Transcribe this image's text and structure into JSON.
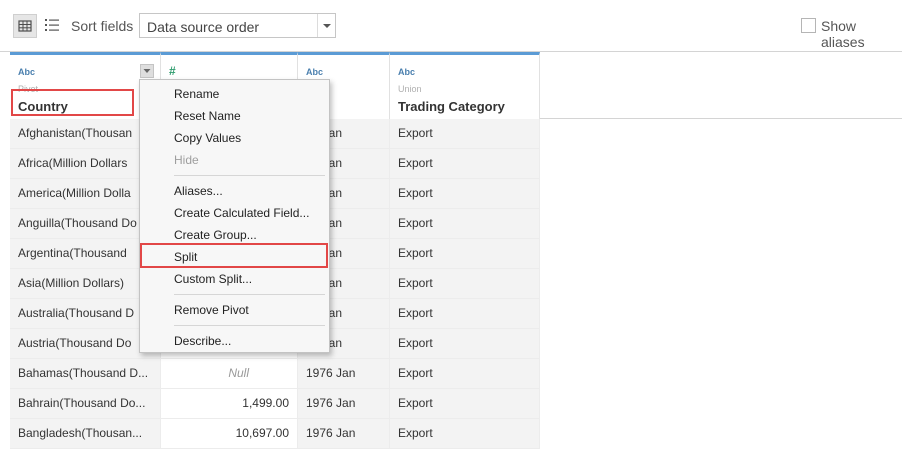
{
  "toolbar": {
    "grid_view_icon": "grid-icon",
    "list_view_icon": "list-icon",
    "sort_label": "Sort fields",
    "sort_value": "Data source order",
    "show_aliases_label": "Show aliases",
    "show_aliases_checked": false
  },
  "columns": [
    {
      "type": "Abc",
      "source": "Pivot",
      "name": "Country"
    },
    {
      "type": "#",
      "source": "",
      "name": ""
    },
    {
      "type": "Abc",
      "source": "",
      "name": "e"
    },
    {
      "type": "Abc",
      "source": "Union",
      "name": "Trading Category"
    }
  ],
  "rows": [
    {
      "country": "Afghanistan(Thousan",
      "value": "",
      "date": "76 Jan",
      "category": "Export"
    },
    {
      "country": "Africa(Million Dollars",
      "value": "",
      "date": "76 Jan",
      "category": "Export"
    },
    {
      "country": "America(Million Dolla",
      "value": "",
      "date": "76 Jan",
      "category": "Export"
    },
    {
      "country": "Anguilla(Thousand Do",
      "value": "",
      "date": "76 Jan",
      "category": "Export"
    },
    {
      "country": "Argentina(Thousand",
      "value": "",
      "date": "76 Jan",
      "category": "Export"
    },
    {
      "country": "Asia(Million Dollars)",
      "value": "",
      "date": "76 Jan",
      "category": "Export"
    },
    {
      "country": "Australia(Thousand D",
      "value": "",
      "date": "76 Jan",
      "category": "Export"
    },
    {
      "country": "Austria(Thousand Do",
      "value": "",
      "date": "76 Jan",
      "category": "Export"
    },
    {
      "country": "Bahamas(Thousand D...",
      "value": "Null",
      "date": "1976 Jan",
      "category": "Export"
    },
    {
      "country": "Bahrain(Thousand Do...",
      "value": "1,499.00",
      "date": "1976 Jan",
      "category": "Export"
    },
    {
      "country": "Bangladesh(Thousan...",
      "value": "10,697.00",
      "date": "1976 Jan",
      "category": "Export"
    }
  ],
  "context_menu": {
    "items": [
      {
        "label": "Rename",
        "disabled": false
      },
      {
        "label": "Reset Name",
        "disabled": false
      },
      {
        "label": "Copy Values",
        "disabled": false
      },
      {
        "label": "Hide",
        "disabled": true
      },
      {
        "label": "Aliases...",
        "disabled": false
      },
      {
        "label": "Create Calculated Field...",
        "disabled": false
      },
      {
        "label": "Create Group...",
        "disabled": false
      },
      {
        "label": "Split",
        "disabled": false
      },
      {
        "label": "Custom Split...",
        "disabled": false
      },
      {
        "label": "Remove Pivot",
        "disabled": false
      },
      {
        "label": "Describe...",
        "disabled": false
      }
    ]
  },
  "colors": {
    "header_accent": "#5b9bd5",
    "highlight": "#e24747",
    "type_label": "#4a7fae"
  }
}
